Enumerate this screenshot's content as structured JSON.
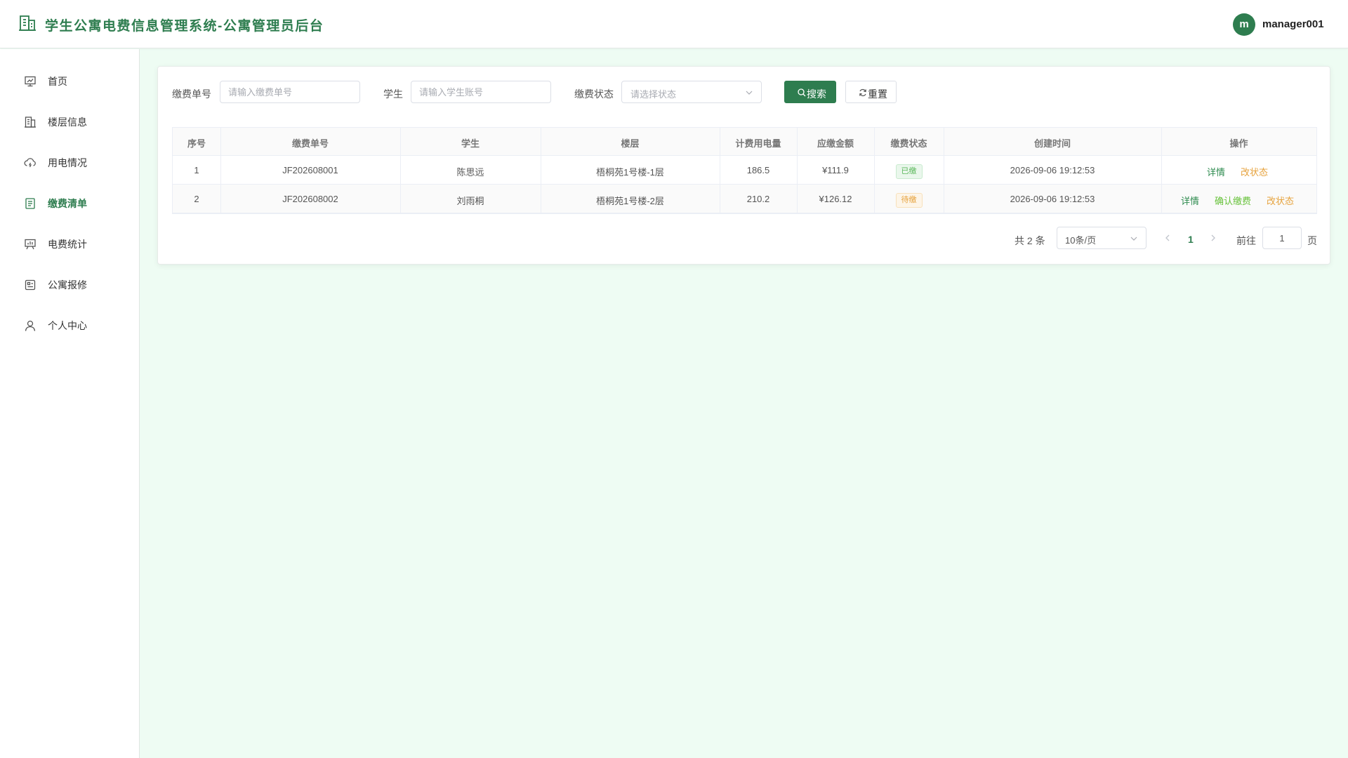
{
  "header": {
    "title": "学生公寓电费信息管理系统-公寓管理员后台",
    "avatar_letter": "m",
    "username": "manager001"
  },
  "sidebar": {
    "items": [
      {
        "label": "首页",
        "icon": "dashboard-icon"
      },
      {
        "label": "楼层信息",
        "icon": "building-icon"
      },
      {
        "label": "用电情况",
        "icon": "cloud-icon"
      },
      {
        "label": "缴费清单",
        "icon": "document-list-icon",
        "active": true
      },
      {
        "label": "电费统计",
        "icon": "presentation-chart-icon"
      },
      {
        "label": "公寓报修",
        "icon": "repair-report-icon"
      },
      {
        "label": "个人中心",
        "icon": "user-icon"
      }
    ]
  },
  "filters": {
    "payment_no_label": "缴费单号",
    "payment_no_placeholder": "请输入缴费单号",
    "student_label": "学生",
    "student_placeholder": "请输入学生账号",
    "status_label": "缴费状态",
    "status_placeholder": "请选择状态",
    "search_label": "搜索",
    "reset_label": "重置"
  },
  "table": {
    "columns": [
      "序号",
      "缴费单号",
      "学生",
      "楼层",
      "计费用电量",
      "应缴金额",
      "缴费状态",
      "创建时间",
      "操作"
    ],
    "rows": [
      {
        "index": "1",
        "payment_no": "JF202608001",
        "student": "陈思远",
        "floor": "梧桐苑1号楼-1层",
        "usage": "186.5",
        "amount": "¥111.9",
        "status": "已缴",
        "status_type": "paid",
        "created": "2026-09-06 19:12:53",
        "actions": [
          "详情",
          "改状态"
        ]
      },
      {
        "index": "2",
        "payment_no": "JF202608002",
        "student": "刘雨桐",
        "floor": "梧桐苑1号楼-2层",
        "usage": "210.2",
        "amount": "¥126.12",
        "status": "待缴",
        "status_type": "pending",
        "created": "2026-09-06 19:12:53",
        "actions": [
          "详情",
          "确认缴费",
          "改状态"
        ]
      }
    ]
  },
  "pagination": {
    "total": "共 2 条",
    "page_size": "10条/页",
    "current": "1",
    "goto_label": "前往",
    "goto_value": "1",
    "goto_suffix": "页"
  },
  "colors": {
    "primary": "#2e7d4f",
    "background": "#eefcf3",
    "paid": "#5cb85c",
    "pending": "#e6a23c"
  }
}
